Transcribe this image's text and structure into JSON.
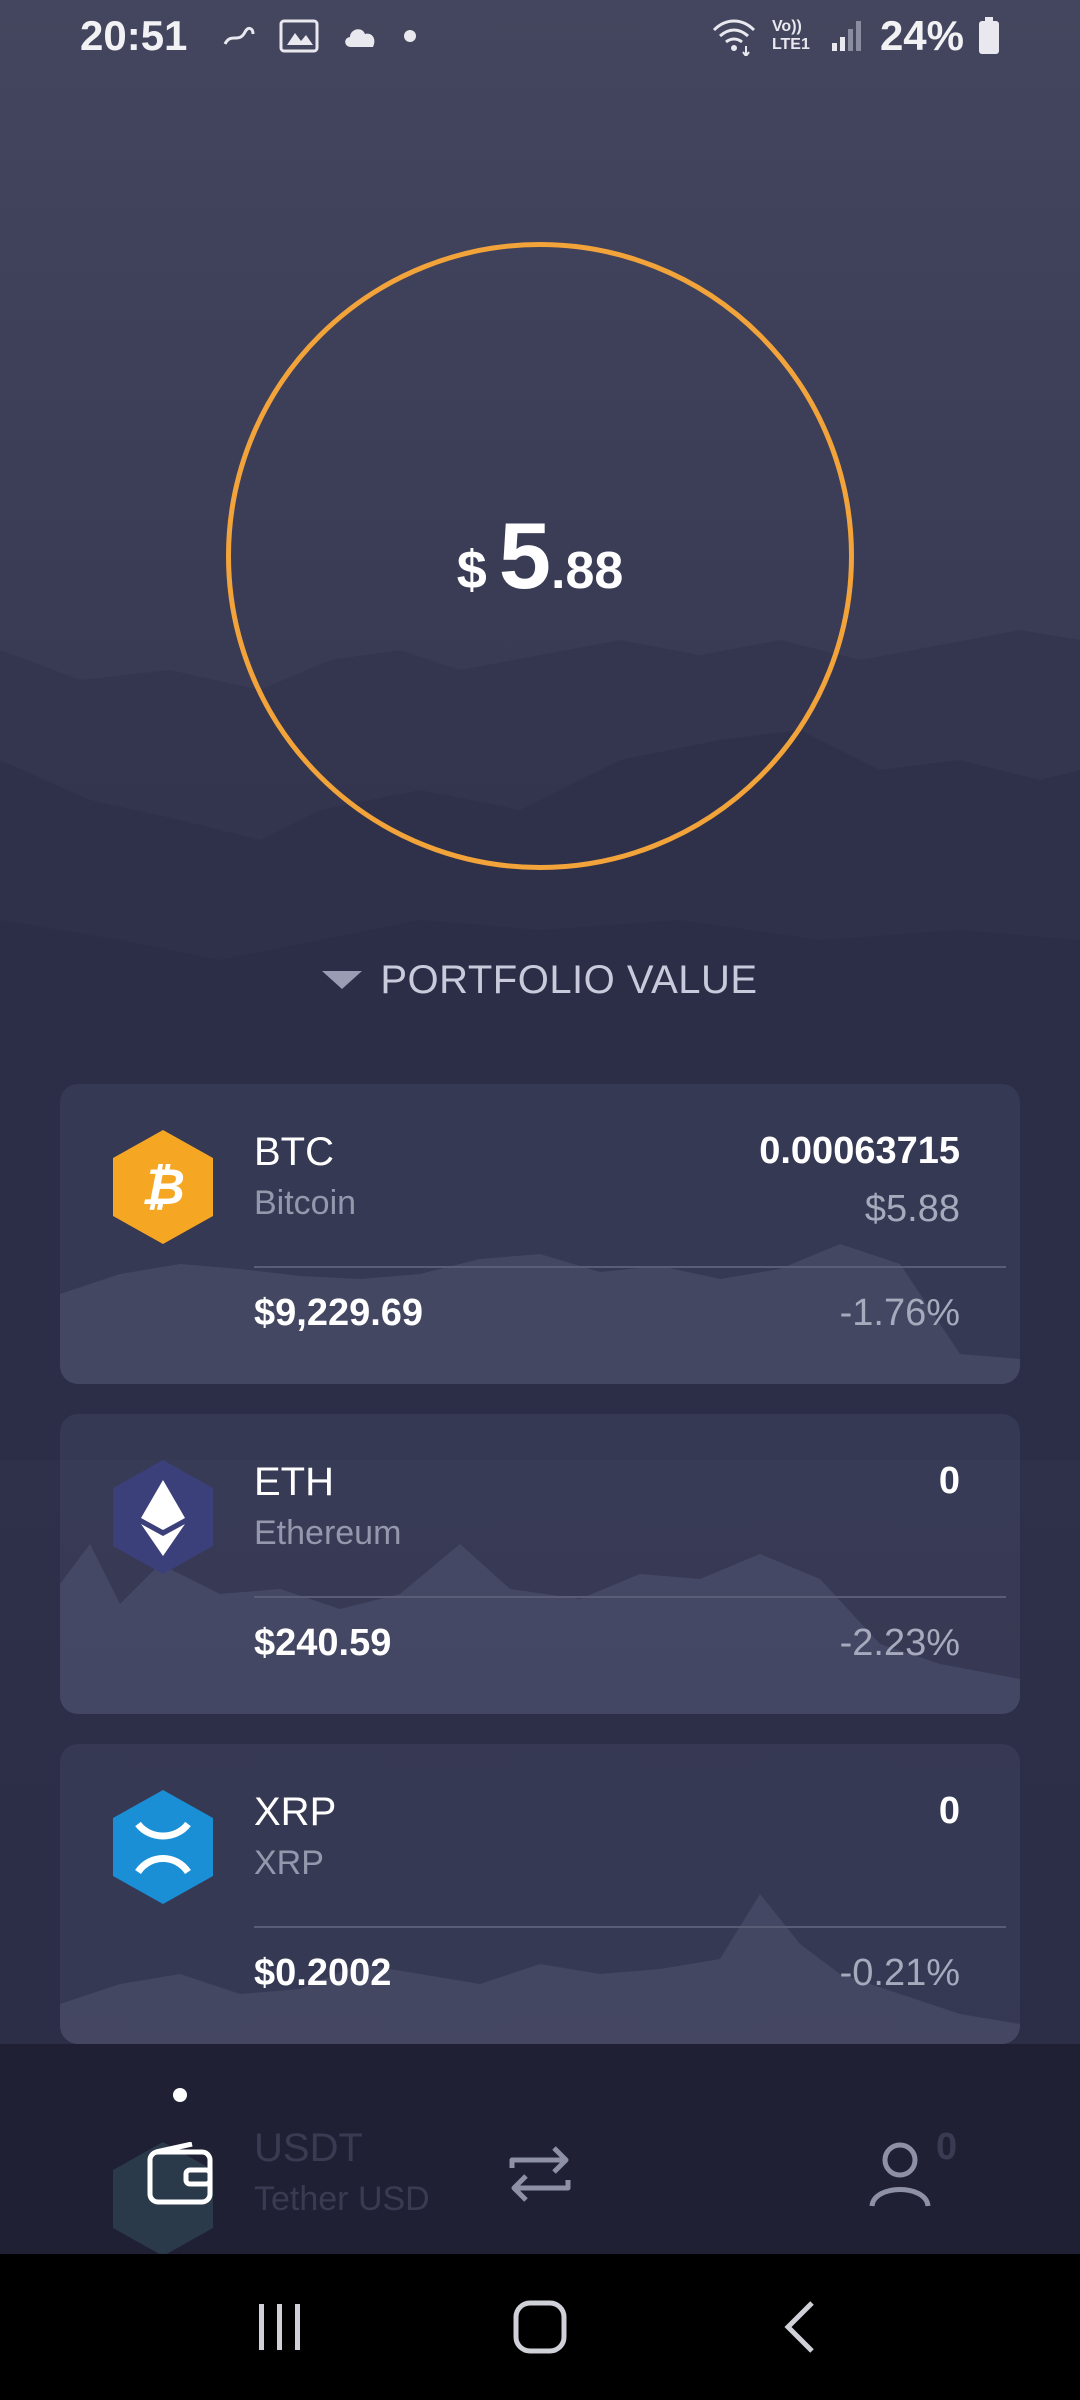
{
  "status_bar": {
    "time": "20:51",
    "battery": "24%",
    "network": "Vo)) LTE1"
  },
  "balance": {
    "currency_symbol": "$",
    "integer": "5",
    "decimals": ".88"
  },
  "portfolio_label": "PORTFOLIO VALUE",
  "assets": [
    {
      "symbol": "BTC",
      "name": "Bitcoin",
      "amount": "0.00063715",
      "fiat_value": "$5.88",
      "price": "$9,229.69",
      "change": "-1.76%",
      "icon": "bitcoin-icon",
      "color": "#f5a623"
    },
    {
      "symbol": "ETH",
      "name": "Ethereum",
      "amount": "0",
      "fiat_value": "",
      "price": "$240.59",
      "change": "-2.23%",
      "icon": "ethereum-icon",
      "color": "#3b3f7a"
    },
    {
      "symbol": "XRP",
      "name": "XRP",
      "amount": "0",
      "fiat_value": "",
      "price": "$0.2002",
      "change": "-0.21%",
      "icon": "xrp-icon",
      "color": "#1a8fd6"
    },
    {
      "symbol": "USDT",
      "name": "Tether USD",
      "amount": "0"
    }
  ],
  "bottom_nav": {
    "items": [
      "wallet-icon",
      "exchange-icon",
      "profile-icon"
    ],
    "active": "wallet-icon"
  },
  "colors": {
    "ring": "#f2a33a",
    "background": "#363852",
    "nav_background": "#1f2033"
  }
}
